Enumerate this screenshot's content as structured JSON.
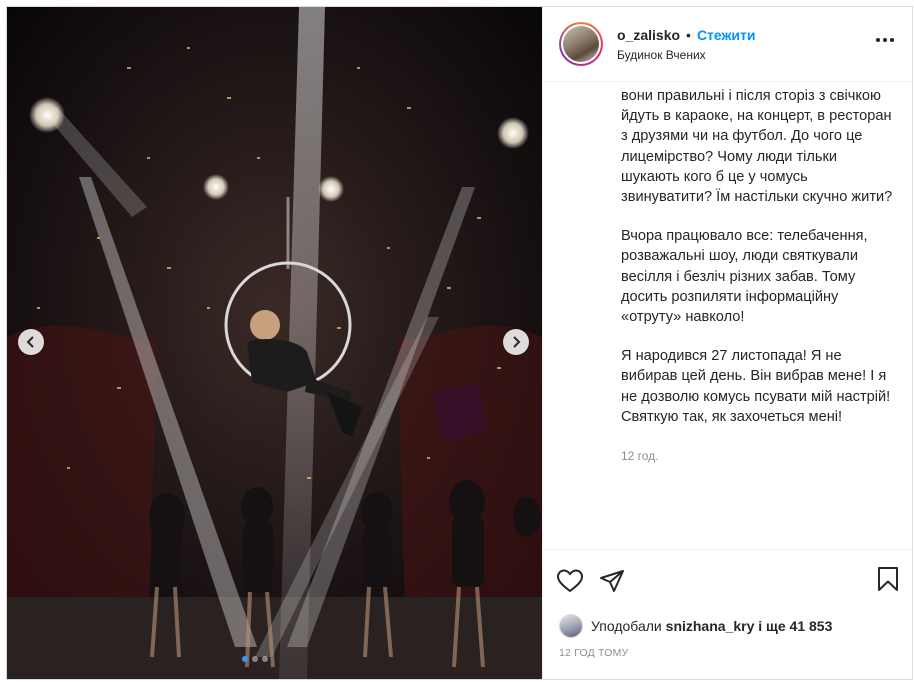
{
  "header": {
    "username": "o_zalisko",
    "separator": "•",
    "follow_label": "Стежити",
    "location": "Будинок Вчених"
  },
  "caption": {
    "paragraphs": [
      "вони правильні і після сторіз з свічкою йдуть в караоке, на концерт, в ресторан з друзями чи на футбол. До чого це лицемірство? Чому люди тільки шукають кого б це у чомусь звинуватити? Їм настільки скучно жити?",
      "Вчора працювало все: телебачення, розважальні шоу, люди святкували весілля і безліч різних забав. Тому досить розпиляти інформаційну «отруту» навколо!",
      "Я народився 27 листопада! Я не вибирав цей день. Він вибрав мене! І я не дозволю комусь псувати мій настрій! Святкую так, як захочеться мені!"
    ],
    "time": "12 год."
  },
  "likes": {
    "prefix": "Уподобали",
    "user": "snizhana_kry",
    "suffix": "і ще 41 853"
  },
  "post_time": "12 ГОД ТОМУ",
  "carousel": {
    "slide_count": 3,
    "active_index": 0
  },
  "icons": {
    "more": "more-options-icon",
    "like": "heart-icon",
    "share": "paper-plane-icon",
    "save": "bookmark-icon",
    "prev": "chevron-left-icon",
    "next": "chevron-right-icon"
  },
  "colors": {
    "follow": "#0095f6",
    "text": "#262626",
    "muted": "#8e8e8e",
    "dot_active": "#3a97f0"
  }
}
